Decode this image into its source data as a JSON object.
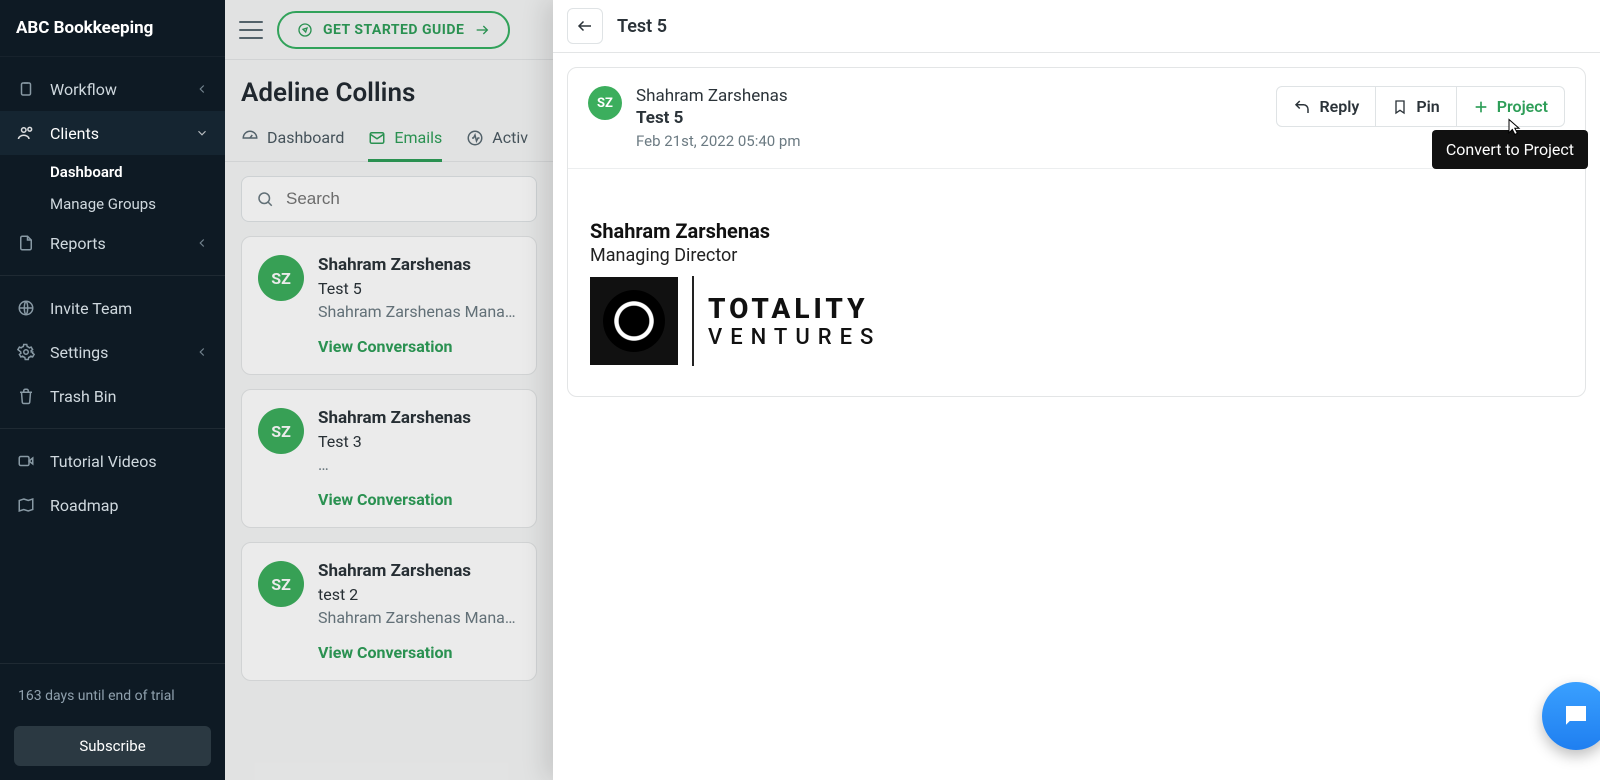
{
  "brand": "ABC Bookkeeping",
  "getStarted": "GET STARTED GUIDE",
  "sidebar": {
    "items": [
      {
        "label": "Workflow"
      },
      {
        "label": "Clients"
      },
      {
        "label": "Reports"
      },
      {
        "label": "Invite Team"
      },
      {
        "label": "Settings"
      },
      {
        "label": "Trash Bin"
      },
      {
        "label": "Tutorial Videos"
      },
      {
        "label": "Roadmap"
      }
    ],
    "clientSub": {
      "dashboard": "Dashboard",
      "manageGroups": "Manage Groups"
    },
    "trialText": "163 days until end of trial",
    "subscribe": "Subscribe"
  },
  "client": {
    "name": "Adeline Collins"
  },
  "tabs": {
    "dashboard": "Dashboard",
    "emails": "Emails",
    "activity": "Activ"
  },
  "search": {
    "placeholder": "Search"
  },
  "emails": [
    {
      "initials": "SZ",
      "from": "Shahram Zarshenas",
      "subject": "Test 5",
      "preview": "Shahram Zarshenas Managing Director",
      "viewLabel": "View Conversation"
    },
    {
      "initials": "SZ",
      "from": "Shahram Zarshenas",
      "subject": "Test 3",
      "preview": "…",
      "viewLabel": "View Conversation"
    },
    {
      "initials": "SZ",
      "from": "Shahram Zarshenas",
      "subject": "test 2",
      "preview": "Shahram Zarshenas Managing Director",
      "viewLabel": "View Conversation"
    }
  ],
  "panel": {
    "title": "Test 5",
    "from": "Shahram Zarshenas",
    "subject": "Test 5",
    "date": "Feb 21st, 2022 05:40 pm",
    "initials": "SZ",
    "actions": {
      "reply": "Reply",
      "pin": "Pin",
      "project": "Project"
    },
    "signature": {
      "name": "Shahram Zarshenas",
      "title": "Managing Director",
      "logoTop": "TOTALITY",
      "logoBottom": "VENTURES"
    },
    "tooltip": "Convert to Project"
  }
}
